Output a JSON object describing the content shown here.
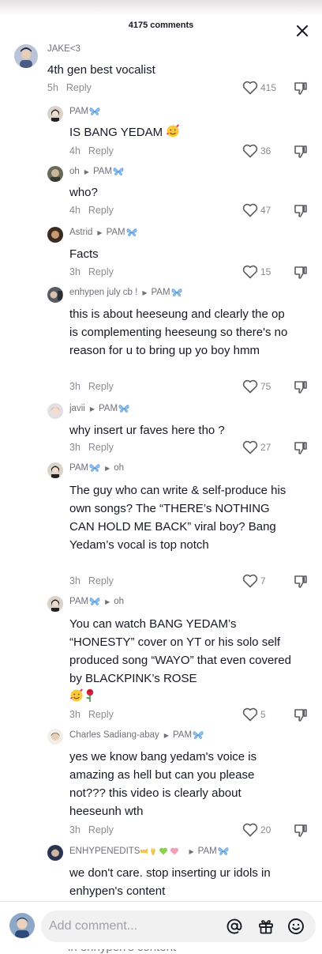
{
  "header": {
    "comment_count": "4175 comments"
  },
  "comments": [
    {
      "user": "JAKE<3",
      "text": "4th gen best vocalist",
      "time": "5h",
      "reply": "Reply",
      "likes": "415"
    },
    {
      "user": "PAM",
      "text": "IS BANG YEDAM",
      "time": "4h",
      "reply": "Reply",
      "likes": "36"
    },
    {
      "user": "oh",
      "reply_to": "PAM",
      "text": "who?",
      "time": "4h",
      "reply": "Reply",
      "likes": "47"
    },
    {
      "user": "Astrid",
      "reply_to": "PAM",
      "text": "Facts",
      "time": "3h",
      "reply": "Reply",
      "likes": "15"
    },
    {
      "user": "enhypen july cb !",
      "reply_to": "PAM",
      "text": "this is about heeseung and clearly the op is complementing heeseung so there's no reason for u to bring up yo boy hmm",
      "time": "3h",
      "reply": "Reply",
      "likes": "75"
    },
    {
      "user": "javii",
      "reply_to": "PAM",
      "text": "why insert ur faves here tho ?",
      "time": "3h",
      "reply": "Reply",
      "likes": "27"
    },
    {
      "user": "PAM",
      "reply_to": "oh",
      "text": "The guy who can write & self-produce his own songs? The “THERE’s NOTHING CAN HOLD ME BACK” viral boy? Bang Yedam’s vocal is top notch",
      "time": "3h",
      "reply": "Reply",
      "likes": "7"
    },
    {
      "user": "PAM",
      "reply_to": "oh",
      "text": "You can watch BANG YEDAM’s “HONESTY” cover on YT or his solo self produced song “WAYO” that even covered by BLACKPINK’s ROSE",
      "time": "3h",
      "reply": "Reply",
      "likes": "5"
    },
    {
      "user": "Charles Sadiang-abay",
      "reply_to": "PAM",
      "text": "yes we know bang yedam's voice is amazing as hell but can you please not??? this video is clearly about heeseunh wth",
      "time": "3h",
      "reply": "Reply",
      "likes": "20"
    },
    {
      "user": "ENHYPENEDITS",
      "reply_to": "PAM",
      "text": "we don't care. stop inserting ur idols in enhypen's content"
    }
  ],
  "composer": {
    "placeholder": "Add comment..."
  },
  "ghost_text": "in enhypen's content",
  "colors": {
    "text": "#161823",
    "muted": "#8a8b91",
    "username": "#6f7078",
    "input_bg": "#f1f1f2"
  },
  "icons": [
    "close-icon",
    "heart-outline-icon",
    "dislike-icon",
    "butterfly-emoji",
    "smiling-hearts-emoji",
    "rose-emoji",
    "at-mention-icon",
    "gift-icon",
    "emoji-icon"
  ]
}
